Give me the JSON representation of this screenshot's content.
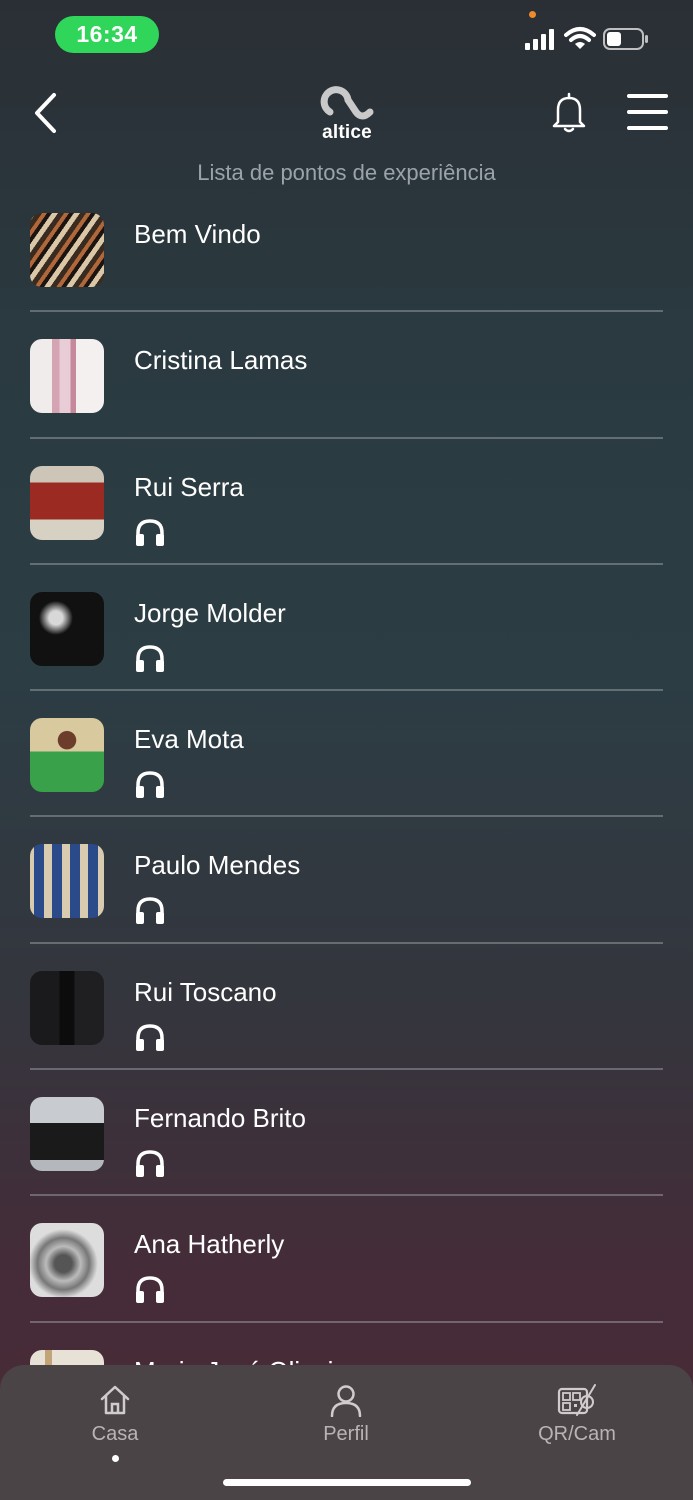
{
  "status_bar": {
    "time": "16:34"
  },
  "header": {
    "logo_text": "altice",
    "title": "Lista de pontos de experiência"
  },
  "list": {
    "items": [
      {
        "label": "Bem Vindo",
        "audio": false
      },
      {
        "label": "Cristina Lamas",
        "audio": false
      },
      {
        "label": "Rui Serra",
        "audio": true
      },
      {
        "label": "Jorge Molder",
        "audio": true
      },
      {
        "label": "Eva Mota",
        "audio": true
      },
      {
        "label": "Paulo Mendes",
        "audio": true
      },
      {
        "label": "Rui Toscano",
        "audio": true
      },
      {
        "label": "Fernando Brito",
        "audio": true
      },
      {
        "label": "Ana Hatherly",
        "audio": true
      },
      {
        "label": "Maria José Oliveira",
        "audio": false
      }
    ]
  },
  "tab_bar": {
    "tabs": [
      {
        "label": "Casa",
        "icon": "home-icon",
        "active": true
      },
      {
        "label": "Perfil",
        "icon": "profile-icon",
        "active": false
      },
      {
        "label": "QR/Cam",
        "icon": "qr-camera-icon",
        "active": false
      }
    ]
  },
  "colors": {
    "time_pill": "#2fd65a",
    "tab_bar": "#4b4446"
  }
}
